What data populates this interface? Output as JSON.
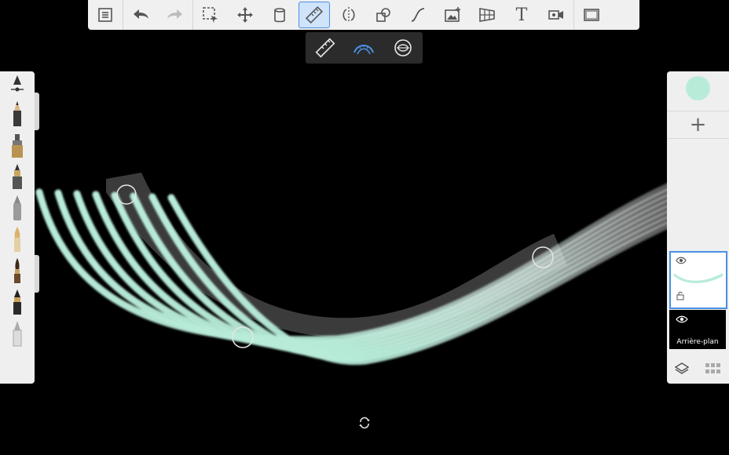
{
  "app": {
    "accent": "#4a90e2",
    "stroke_color": "#b8ecd9"
  },
  "toolbar": {
    "items": [
      {
        "name": "list-icon"
      },
      {
        "name": "undo-icon"
      },
      {
        "name": "redo-icon"
      },
      {
        "name": "selection-icon"
      },
      {
        "name": "transform-icon"
      },
      {
        "name": "fill-icon"
      },
      {
        "name": "ruler-icon",
        "active": true
      },
      {
        "name": "symmetry-icon"
      },
      {
        "name": "shapes-icon"
      },
      {
        "name": "curve-icon"
      },
      {
        "name": "image-icon"
      },
      {
        "name": "perspective-icon"
      },
      {
        "name": "text-icon",
        "label": "T"
      },
      {
        "name": "timelapse-icon"
      },
      {
        "name": "fullscreen-icon"
      }
    ]
  },
  "subbar": {
    "items": [
      {
        "name": "straight-ruler-icon"
      },
      {
        "name": "french-curve-icon",
        "active": true
      },
      {
        "name": "ellipse-guide-icon"
      }
    ]
  },
  "brushes": {
    "items": [
      "brush-size-icon",
      "pencil-icon",
      "marker-icon",
      "ink-pen-icon",
      "airbrush-icon",
      "fountain-pen-icon",
      "paintbrush-icon",
      "calligraphy-pen-icon",
      "smudge-icon"
    ]
  },
  "layers": {
    "add_label": "+",
    "background_label": "Arrière-plan"
  }
}
